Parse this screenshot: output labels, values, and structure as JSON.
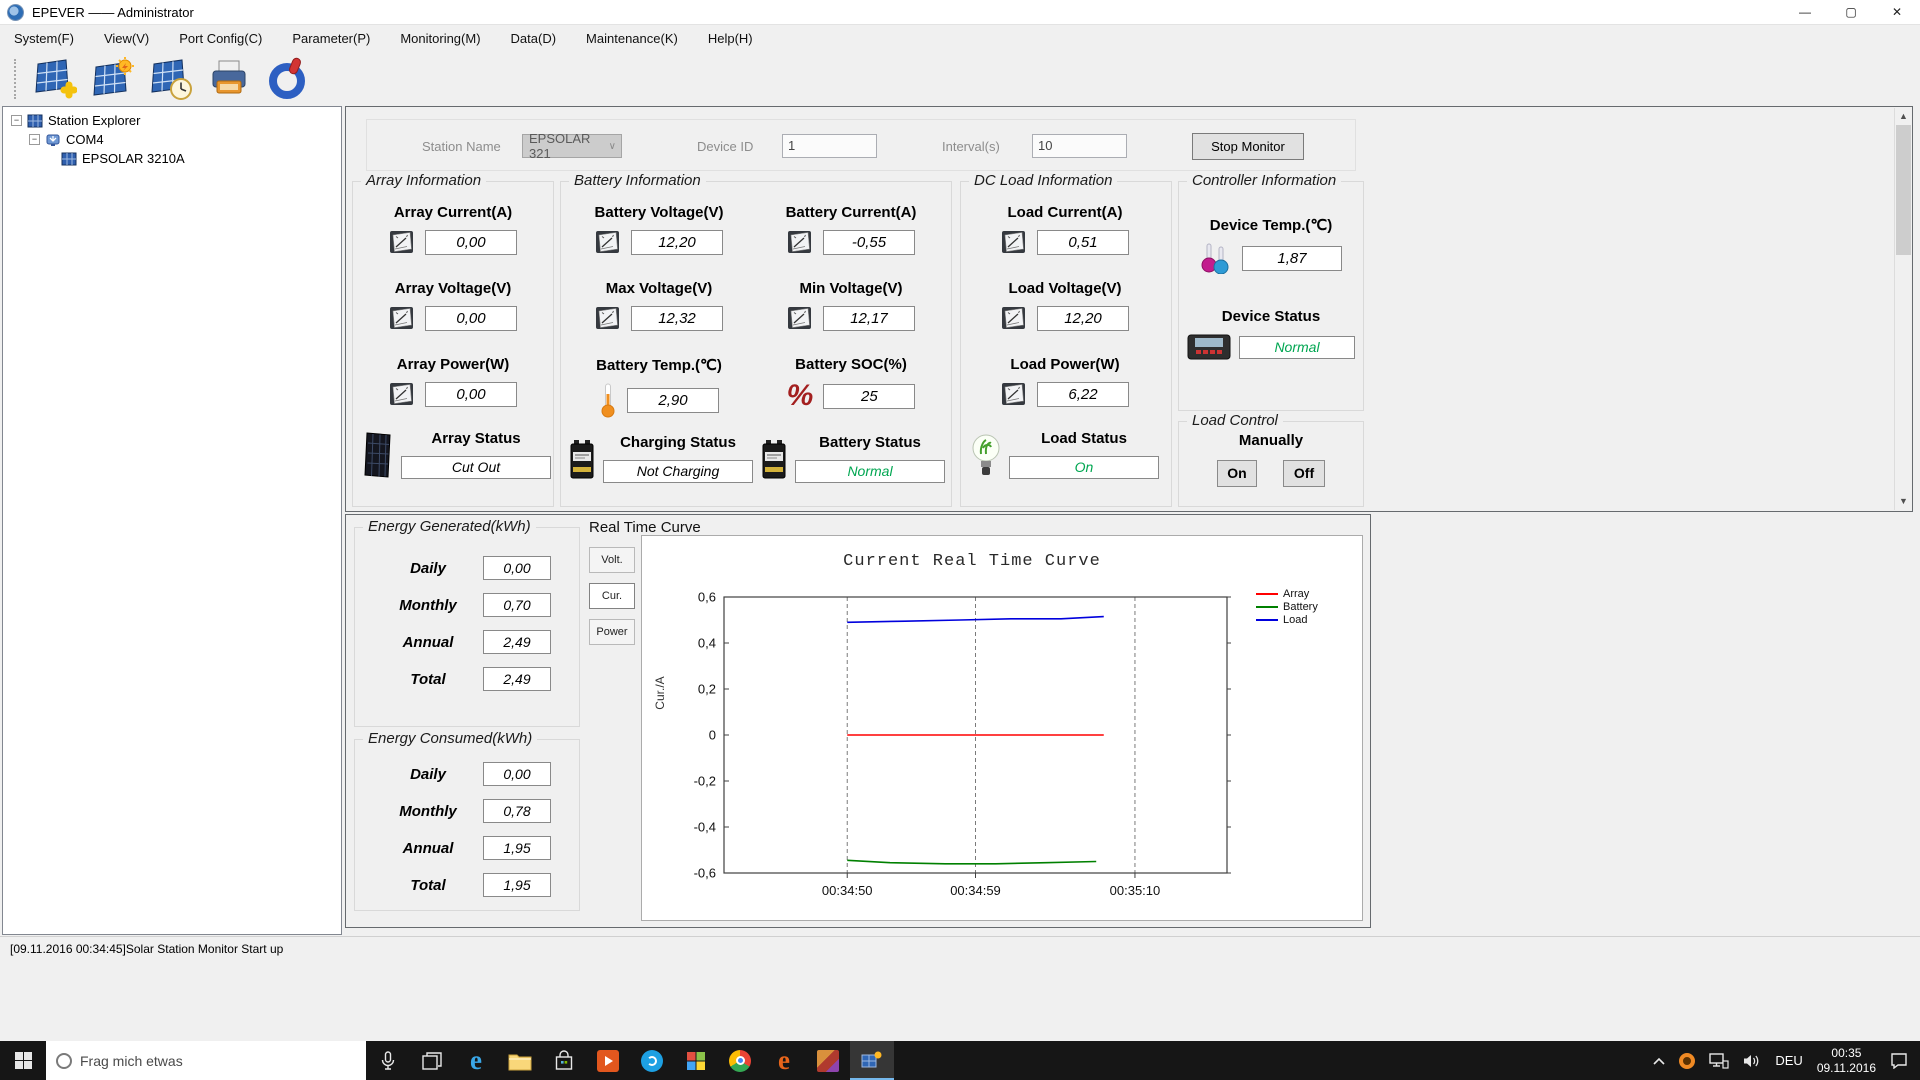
{
  "window": {
    "title": "EPEVER —— Administrator"
  },
  "menu": {
    "items": [
      "System(F)",
      "View(V)",
      "Port Config(C)",
      "Parameter(P)",
      "Monitoring(M)",
      "Data(D)",
      "Maintenance(K)",
      "Help(H)"
    ]
  },
  "toolbar": {
    "buttons": [
      "add-station",
      "station-parameter",
      "real-time-monitor",
      "print",
      "exit"
    ]
  },
  "tree": {
    "items": [
      {
        "label": "Station Explorer",
        "icon": "solar-panel-icon"
      },
      {
        "label": "COM4",
        "icon": "com-port-icon"
      },
      {
        "label": "EPSOLAR 3210A",
        "icon": "solar-panel-icon"
      }
    ]
  },
  "settings": {
    "station_name_label": "Station Name",
    "station_name_value": "EPSOLAR 321",
    "device_id_label": "Device ID",
    "device_id_value": "1",
    "interval_label": "Interval(s)",
    "interval_value": "10",
    "stop_button_label": "Stop Monitor"
  },
  "array_info": {
    "title": "Array Information",
    "metrics": [
      {
        "label": "Array Current(A)",
        "value": "0,00",
        "icon": "meter-icon"
      },
      {
        "label": "Array Voltage(V)",
        "value": "0,00",
        "icon": "meter-icon"
      },
      {
        "label": "Array Power(W)",
        "value": "0,00",
        "icon": "meter-icon"
      }
    ],
    "status": {
      "label": "Array Status",
      "value": "Cut Out",
      "color": "#000000",
      "icon": "solar-panel-icon"
    }
  },
  "battery_info": {
    "title": "Battery Information",
    "metrics": [
      {
        "label": "Battery Voltage(V)",
        "value": "12,20",
        "icon": "meter-icon"
      },
      {
        "label": "Battery Current(A)",
        "value": "-0,55",
        "icon": "meter-icon"
      },
      {
        "label": "Max Voltage(V)",
        "value": "12,32",
        "icon": "meter-icon"
      },
      {
        "label": "Min Voltage(V)",
        "value": "12,17",
        "icon": "meter-icon"
      },
      {
        "label": "Battery Temp.(℃)",
        "value": "2,90",
        "icon": "thermometer-icon"
      },
      {
        "label": "Battery SOC(%)",
        "value": "25",
        "icon": "percent-icon"
      }
    ],
    "statuses": [
      {
        "label": "Charging Status",
        "value": "Not Charging",
        "color": "#000000",
        "icon": "battery-icon"
      },
      {
        "label": "Battery Status",
        "value": "Normal",
        "color": "#00a651",
        "icon": "battery-icon"
      }
    ]
  },
  "load_info": {
    "title": "DC Load Information",
    "metrics": [
      {
        "label": "Load Current(A)",
        "value": "0,51",
        "icon": "meter-icon"
      },
      {
        "label": "Load Voltage(V)",
        "value": "12,20",
        "icon": "meter-icon"
      },
      {
        "label": "Load Power(W)",
        "value": "6,22",
        "icon": "meter-icon"
      }
    ],
    "status": {
      "label": "Load Status",
      "value": "On",
      "color": "#00a651",
      "icon": "bulb-icon"
    }
  },
  "controller_info": {
    "title": "Controller Information",
    "temp_label": "Device Temp.(℃)",
    "temp_value": "1,87",
    "status_label": "Device Status",
    "status_value": "Normal",
    "status_color": "#00a651"
  },
  "load_control": {
    "title": "Load Control",
    "mode_label": "Manually",
    "on_label": "On",
    "off_label": "Off"
  },
  "energy_generated": {
    "title": "Energy Generated(kWh)",
    "rows": [
      {
        "label": "Daily",
        "value": "0,00"
      },
      {
        "label": "Monthly",
        "value": "0,70"
      },
      {
        "label": "Annual",
        "value": "2,49"
      },
      {
        "label": "Total",
        "value": "2,49"
      }
    ]
  },
  "energy_consumed": {
    "title": "Energy Consumed(kWh)",
    "rows": [
      {
        "label": "Daily",
        "value": "0,00"
      },
      {
        "label": "Monthly",
        "value": "0,78"
      },
      {
        "label": "Annual",
        "value": "1,95"
      },
      {
        "label": "Total",
        "value": "1,95"
      }
    ]
  },
  "real_time_curve": {
    "panel_title": "Real Time Curve",
    "tabs": [
      "Volt.",
      "Cur.",
      "Power"
    ],
    "active_tab": "Cur.",
    "chart_data": {
      "type": "line",
      "title": "Current Real Time Curve",
      "ylabel": "Cur./A",
      "ylim": [
        -0.6,
        0.6
      ],
      "yticks": [
        0.6,
        0.4,
        0.2,
        0,
        -0.2,
        -0.4,
        -0.6
      ],
      "ytick_labels": [
        "0,6",
        "0,4",
        "0,2",
        "0",
        "-0,2",
        "-0,4",
        "-0,6"
      ],
      "xtick_labels": [
        "00:34:50",
        "00:34:59",
        "00:35:10"
      ],
      "xtick_fractions": [
        0.245,
        0.5,
        0.817
      ],
      "grid": "vertical-dashed",
      "legend_position": "top-right",
      "series": [
        {
          "name": "Array",
          "color": "#ff0000",
          "points": [
            [
              0.245,
              0.0
            ],
            [
              0.5,
              0.0
            ],
            [
              0.755,
              0.0
            ]
          ]
        },
        {
          "name": "Battery",
          "color": "#008000",
          "points": [
            [
              0.245,
              -0.545
            ],
            [
              0.33,
              -0.555
            ],
            [
              0.44,
              -0.56
            ],
            [
              0.54,
              -0.56
            ],
            [
              0.64,
              -0.555
            ],
            [
              0.74,
              -0.55
            ]
          ]
        },
        {
          "name": "Load",
          "color": "#0000dd",
          "points": [
            [
              0.245,
              0.49
            ],
            [
              0.36,
              0.495
            ],
            [
              0.47,
              0.5
            ],
            [
              0.57,
              0.505
            ],
            [
              0.67,
              0.505
            ],
            [
              0.755,
              0.515
            ]
          ]
        }
      ]
    }
  },
  "status_bar": {
    "message": "[09.11.2016 00:34:45]Solar Station Monitor Start up"
  },
  "taskbar": {
    "search_placeholder": "Frag mich etwas",
    "language": "DEU",
    "time": "00:35",
    "date": "09.11.2016"
  }
}
